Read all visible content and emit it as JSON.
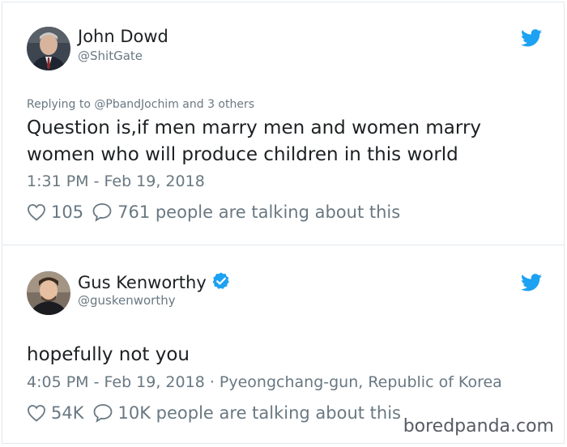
{
  "tweets": [
    {
      "name": "John Dowd",
      "handle": "@ShitGate",
      "replying": "Replying to @PbandJochim and 3 others",
      "text": "Question is,if men marry men and women marry women who will produce children in this world",
      "timestamp": "1:31 PM - Feb 19, 2018",
      "likes": "105",
      "replies": "761 people are talking about this",
      "verified": false
    },
    {
      "name": "Gus Kenworthy",
      "handle": "@guskenworthy",
      "text": "hopefully not you",
      "timestamp": "4:05 PM - Feb 19, 2018 · Pyeongchang-gun, Republic of Korea",
      "likes": "54K",
      "replies": "10K people are talking about this",
      "verified": true
    }
  ],
  "watermark": "boredpanda.com",
  "colors": {
    "twitter_blue": "#1da1f2",
    "secondary_text": "#697882",
    "primary_text": "#1c2022",
    "border": "#e1e8ed"
  },
  "icons": [
    "twitter-bird-icon",
    "heart-icon",
    "comment-icon",
    "verified-badge-icon"
  ]
}
